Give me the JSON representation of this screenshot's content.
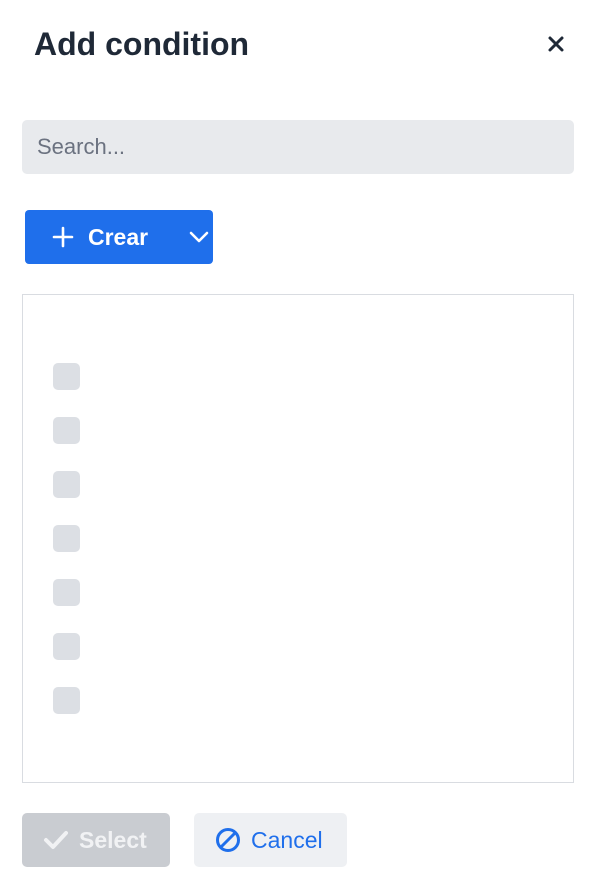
{
  "dialog": {
    "title": "Add condition",
    "close_icon": "close-icon"
  },
  "search": {
    "placeholder": "Search...",
    "value": ""
  },
  "create_button": {
    "label": "Crear",
    "icon_left": "plus-icon",
    "icon_right": "chevron-down-icon"
  },
  "list": {
    "loading_placeholders": 7
  },
  "footer": {
    "select_label": "Select",
    "select_icon": "check-icon",
    "select_disabled": true,
    "cancel_label": "Cancel",
    "cancel_icon": "ban-icon"
  },
  "colors": {
    "accent": "#1f6feb",
    "disabled": "#c9ccd1",
    "skeleton": "#dcdfe4"
  }
}
